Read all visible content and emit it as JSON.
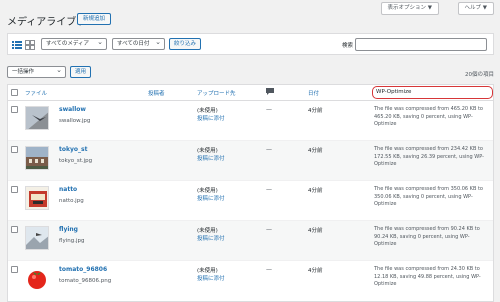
{
  "top": {
    "screen_options": "表示オプション ▼",
    "help": "ヘルプ ▼"
  },
  "page": {
    "title": "メディアライブラリ",
    "add_new": "新規追加"
  },
  "filters": {
    "media_type": "すべてのメディア",
    "dates": "すべての日付",
    "filter_button": "絞り込み",
    "search_label": "検索",
    "search_value": ""
  },
  "bulk": {
    "action": "一括操作",
    "apply": "適用",
    "items_count": "20個の項目"
  },
  "columns": {
    "file": "ファイル",
    "author": "投稿者",
    "uploaded_to": "アップロード先",
    "date": "日付",
    "wpo": "WP-Optimize"
  },
  "rows": [
    {
      "title": "swallow",
      "file": "swallow.jpg",
      "uploaded": "(未使用)",
      "attach": "投稿に添付",
      "author": "—",
      "date": "4分前",
      "wpo": "The file was compressed from 465.20 KB to 465.20 KB, saving 0 percent, using WP-Optimize"
    },
    {
      "title": "tokyo_st",
      "file": "tokyo_st.jpg",
      "uploaded": "(未使用)",
      "attach": "投稿に添付",
      "author": "—",
      "date": "4分前",
      "wpo": "The file was compressed from 234.42 KB to 172.55 KB, saving 26.39 percent, using WP-Optimize"
    },
    {
      "title": "natto",
      "file": "natto.jpg",
      "uploaded": "(未使用)",
      "attach": "投稿に添付",
      "author": "—",
      "date": "4分前",
      "wpo": "The file was compressed from 350.06 KB to 350.06 KB, saving 0 percent, using WP-Optimize"
    },
    {
      "title": "flying",
      "file": "flying.jpg",
      "uploaded": "(未使用)",
      "attach": "投稿に添付",
      "author": "—",
      "date": "4分前",
      "wpo": "The file was compressed from 90.24 KB to 90.24 KB, saving 0 percent, using WP-Optimize"
    },
    {
      "title": "tomato_96806",
      "file": "tomato_96806.png",
      "uploaded": "(未使用)",
      "attach": "投稿に添付",
      "author": "—",
      "date": "4分前",
      "wpo": "The file was compressed from 24.30 KB to 12.18 KB, saving 49.88 percent, using WP-Optimize"
    }
  ],
  "colors": {
    "link": "#2271b1",
    "highlight": "#d63638"
  }
}
